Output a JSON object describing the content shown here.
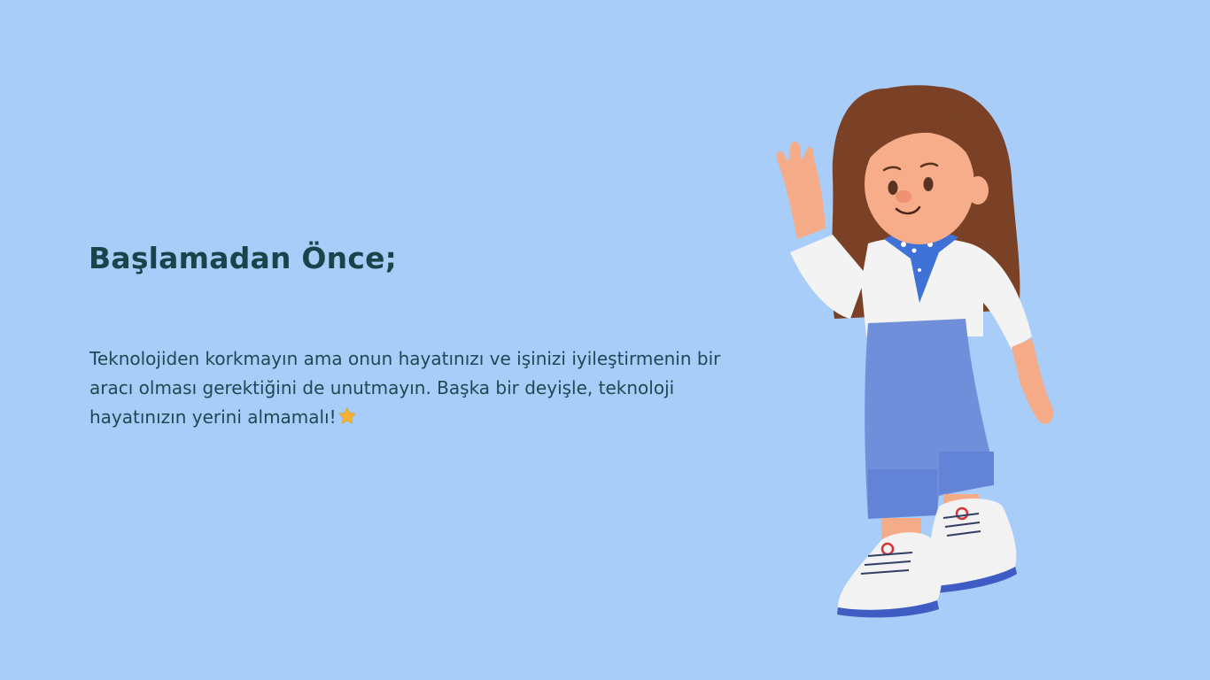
{
  "slide": {
    "title": "Başlamadan Önce;",
    "body": "Teknolojiden korkmayın ama onun hayatınızı ve işinizi iyileştirmenin bir aracı olması gerektiğini de unutmayın. Başka bir deyişle, teknoloji hayatınızın yerini almamalı!",
    "body_icon": "star-icon"
  },
  "colors": {
    "background": "#a7cdf8",
    "title": "#17454b",
    "body": "#1d4a52",
    "star": "#f5b335"
  },
  "illustration": {
    "icon": "waving-girl-illustration"
  }
}
